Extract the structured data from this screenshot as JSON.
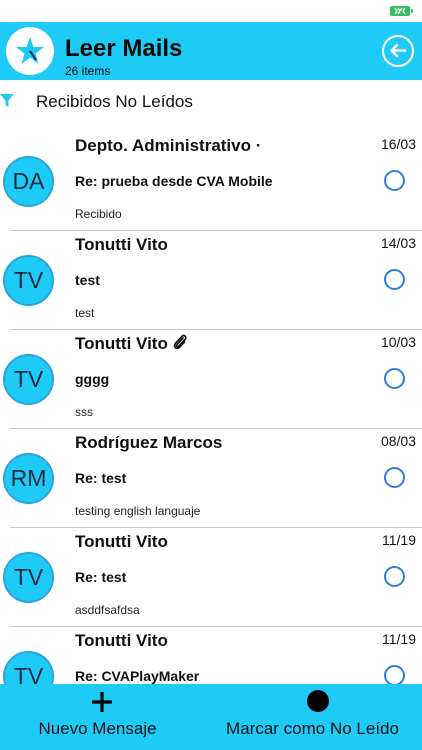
{
  "colors": {
    "accent": "#1ecbf7",
    "avatar_border": "#2aa4d9",
    "radio_border": "#2f7dd6",
    "battery": "#33c05a"
  },
  "header": {
    "title": "Leer Mails",
    "count": "26 items",
    "app_icon": "star-compass-icon",
    "back_icon": "back-arrow-icon"
  },
  "filter": {
    "icon": "funnel-icon",
    "label": "Recibidos No Leídos"
  },
  "mails": [
    {
      "initials": "DA",
      "sender": "Depto. Administrativo ·",
      "date": "16/03",
      "subject": "Re: prueba desde CVA Mobile",
      "preview": "Recibido",
      "has_attachment": false
    },
    {
      "initials": "TV",
      "sender": "Tonutti Vito",
      "date": "14/03",
      "subject": "test",
      "preview": "test",
      "has_attachment": false
    },
    {
      "initials": "TV",
      "sender": "Tonutti Vito",
      "date": "10/03",
      "subject": "gggg",
      "preview": "sss",
      "has_attachment": true
    },
    {
      "initials": "RM",
      "sender": "Rodríguez Marcos",
      "date": "08/03",
      "subject": "Re: test",
      "preview": "testing english languaje",
      "has_attachment": false
    },
    {
      "initials": "TV",
      "sender": "Tonutti Vito",
      "date": "11/19",
      "subject": "Re: test",
      "preview": "asddfsafdsa",
      "has_attachment": false
    },
    {
      "initials": "TV",
      "sender": "Tonutti Vito",
      "date": "11/19",
      "subject": "Re: CVAPlayMaker",
      "preview": "",
      "has_attachment": false
    }
  ],
  "toolbar": {
    "new_message_label": "Nuevo Mensaje",
    "new_message_icon": "plus-icon",
    "mark_unread_label": "Marcar como No Leído",
    "mark_unread_icon": "filled-dot-icon"
  }
}
